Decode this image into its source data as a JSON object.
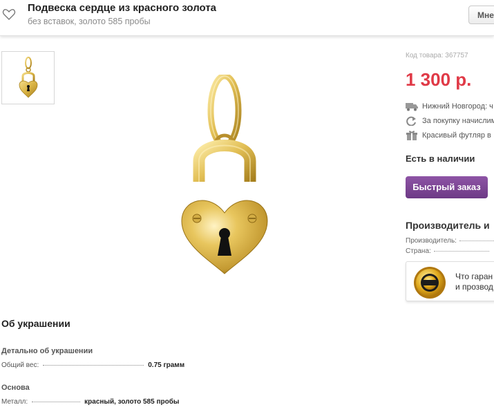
{
  "header": {
    "title": "Подвеска сердце из красного золота",
    "subtitle": "без вставок, золото 585 пробы",
    "button_label": "Мне"
  },
  "product": {
    "sku": "Код товара: 367757",
    "price": "1 300 р.",
    "delivery": "Нижний Новгород: ч",
    "bonus": "За покупку начислим",
    "gift": "Красивый футляр в",
    "stock": "Есть в наличии",
    "quick_order": "Быстрый заказ"
  },
  "maker": {
    "title": "Производитель и",
    "producer_label": "Производитель:",
    "country_label": "Страна:"
  },
  "guarantee": {
    "line1": "Что гаран",
    "line2": "и прозвод"
  },
  "details": {
    "section_title": "Об украшении",
    "group1_title": "Детально об украшении",
    "weight_label": "Общий вес:",
    "weight_value": "0.75 грамм",
    "group2_title": "Основа",
    "metal_label": "Металл:",
    "metal_value": "красный, золото 585 пробы"
  },
  "colors": {
    "price": "#e03a47",
    "button": "#7b4496",
    "gold": "#d9b84a"
  }
}
